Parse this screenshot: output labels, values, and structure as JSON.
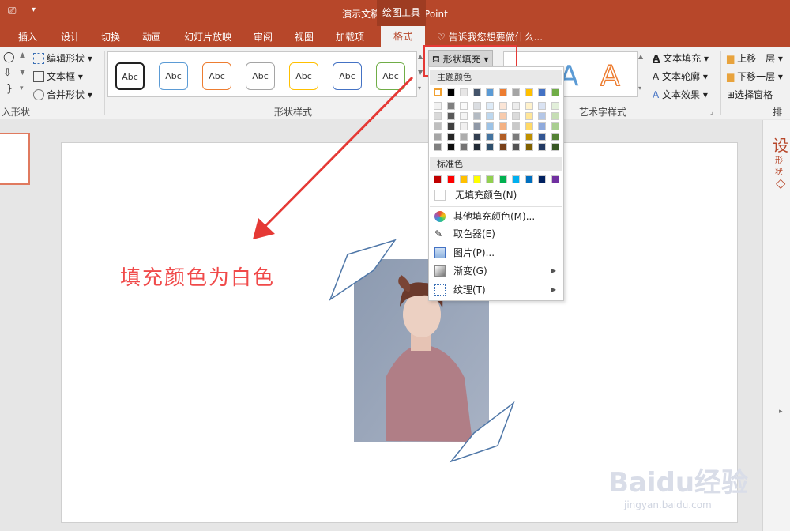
{
  "window": {
    "title": "演示文稿1 - PowerPoint",
    "context_tools": "绘图工具"
  },
  "tabs": [
    "插入",
    "设计",
    "切换",
    "动画",
    "幻灯片放映",
    "审阅",
    "视图",
    "加载项"
  ],
  "active_tab": "格式",
  "tell_me": "告诉我您想要做什么...",
  "ribbon": {
    "insert_shapes": {
      "edit_shape": "编辑形状",
      "text_box": "文本框",
      "merge_shapes": "合并形状",
      "group_label": "入形状"
    },
    "shape_styles": {
      "group_label": "形状样式",
      "samples": [
        "Abc",
        "Abc",
        "Abc",
        "Abc",
        "Abc",
        "Abc",
        "Abc"
      ],
      "sample_colors": [
        "#222222",
        "#5b9bd5",
        "#ed7d31",
        "#a5a5a5",
        "#ffc000",
        "#4472c4",
        "#70ad47"
      ],
      "shape_fill_button": "形状填充"
    },
    "wordart": {
      "group_label": "艺术字样式",
      "text_fill": "文本填充",
      "text_outline": "文本轮廓",
      "text_effects": "文本效果",
      "sample_letter": "A"
    },
    "arrange": {
      "bring_forward": "上移一层",
      "send_backward": "下移一层",
      "selection_pane": "选择窗格",
      "group_label": "排列"
    }
  },
  "fill_menu": {
    "theme_colors_label": "主题颜色",
    "theme_colors": [
      "#ffffff",
      "#000000",
      "#e7e6e6",
      "#44546a",
      "#5b9bd5",
      "#ed7d31",
      "#a5a5a5",
      "#ffc000",
      "#4472c4",
      "#70ad47"
    ],
    "standard_label": "标准色",
    "standard_colors": [
      "#c00000",
      "#ff0000",
      "#ffc000",
      "#ffff00",
      "#92d050",
      "#00b050",
      "#00b0f0",
      "#0070c0",
      "#002060",
      "#7030a0"
    ],
    "no_fill": "无填充颜色(N)",
    "more_colors": "其他填充颜色(M)...",
    "eyedropper": "取色器(E)",
    "picture": "图片(P)...",
    "gradient": "渐变(G)",
    "texture": "纹理(T)"
  },
  "slide": {
    "annotation": "填充颜色为白色"
  },
  "right_pane": {
    "title_char": "设",
    "subtitle_char": "形状"
  },
  "watermark": {
    "logo": "Baidu经验",
    "url": "jingyan.baidu.com"
  }
}
